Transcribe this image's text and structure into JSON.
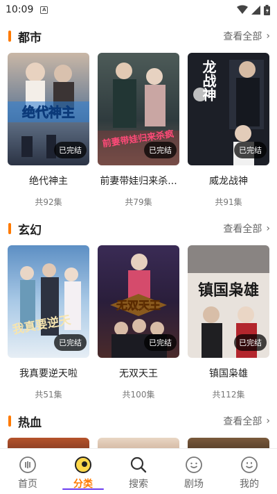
{
  "status": {
    "time": "10:09"
  },
  "sections": [
    {
      "title": "都市",
      "view_all": "查看全部",
      "items": [
        {
          "title": "绝代神主",
          "episodes": "共92集",
          "badge": "已完结",
          "poster_text": "绝代神主"
        },
        {
          "title": "前妻带娃归来杀...",
          "episodes": "共79集",
          "badge": "已完结",
          "poster_text": "前妻带娃归来杀疯"
        },
        {
          "title": "威龙战神",
          "episodes": "共91集",
          "badge": "已完结",
          "poster_text": "龙战神"
        }
      ]
    },
    {
      "title": "玄幻",
      "view_all": "查看全部",
      "items": [
        {
          "title": "我真要逆天啦",
          "episodes": "共51集",
          "badge": "已完结",
          "poster_text": "我真要逆天"
        },
        {
          "title": "无双天王",
          "episodes": "共100集",
          "badge": "已完结",
          "poster_text": "无双天王"
        },
        {
          "title": "镇国枭雄",
          "episodes": "共112集",
          "badge": "已完结",
          "poster_text": "镇国枭雄"
        }
      ]
    },
    {
      "title": "热血",
      "view_all": "查看全部"
    }
  ],
  "tabs": [
    {
      "label": "首页",
      "icon": "home-icon"
    },
    {
      "label": "分类",
      "icon": "category-icon",
      "active": true
    },
    {
      "label": "搜索",
      "icon": "search-icon"
    },
    {
      "label": "剧场",
      "icon": "theater-icon"
    },
    {
      "label": "我的",
      "icon": "profile-icon"
    }
  ],
  "colors": {
    "accent": "#ff7a00",
    "underline": "#6a3cf0"
  }
}
